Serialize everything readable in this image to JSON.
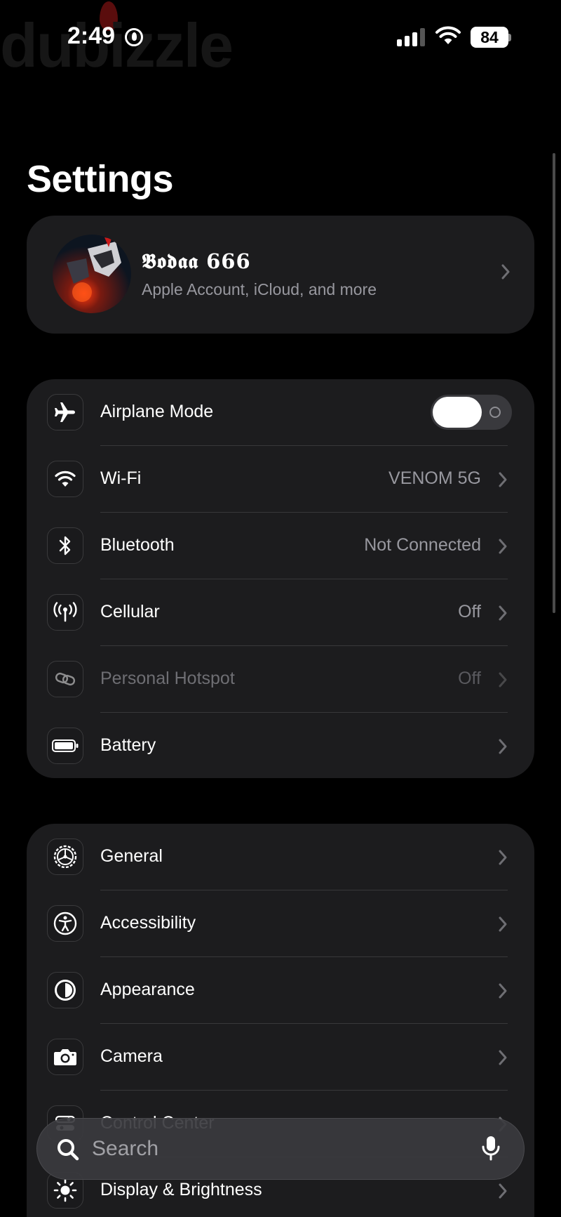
{
  "status_bar": {
    "watermark": "dubizzle",
    "time": "2:49",
    "battery": "84"
  },
  "page": {
    "title": "Settings"
  },
  "profile": {
    "name": "𝕭𝖔𝖉𝖆𝖆 666",
    "subtitle": "Apple Account, iCloud, and more"
  },
  "group_connectivity": [
    {
      "label": "Airplane Mode",
      "icon": "airplane-icon",
      "control": "toggle",
      "state": "off"
    },
    {
      "label": "Wi-Fi",
      "icon": "wifi-icon",
      "value": "VENOM 5G"
    },
    {
      "label": "Bluetooth",
      "icon": "bluetooth-icon",
      "value": "Not Connected"
    },
    {
      "label": "Cellular",
      "icon": "antenna-icon",
      "value": "Off"
    },
    {
      "label": "Personal Hotspot",
      "icon": "hotspot-icon",
      "value": "Off",
      "disabled": true
    },
    {
      "label": "Battery",
      "icon": "battery-icon"
    }
  ],
  "group_general": [
    {
      "label": "General",
      "icon": "gear-icon"
    },
    {
      "label": "Accessibility",
      "icon": "accessibility-icon"
    },
    {
      "label": "Appearance",
      "icon": "appearance-icon"
    },
    {
      "label": "Camera",
      "icon": "camera-icon"
    },
    {
      "label": "Control Center",
      "icon": "control-center-icon"
    },
    {
      "label": "Display & Brightness",
      "icon": "brightness-icon"
    }
  ],
  "search": {
    "placeholder": "Search"
  },
  "colors": {
    "background": "#000000",
    "card": "#1c1c1e",
    "secondary_text": "#98989f",
    "divider": "#38383a"
  }
}
